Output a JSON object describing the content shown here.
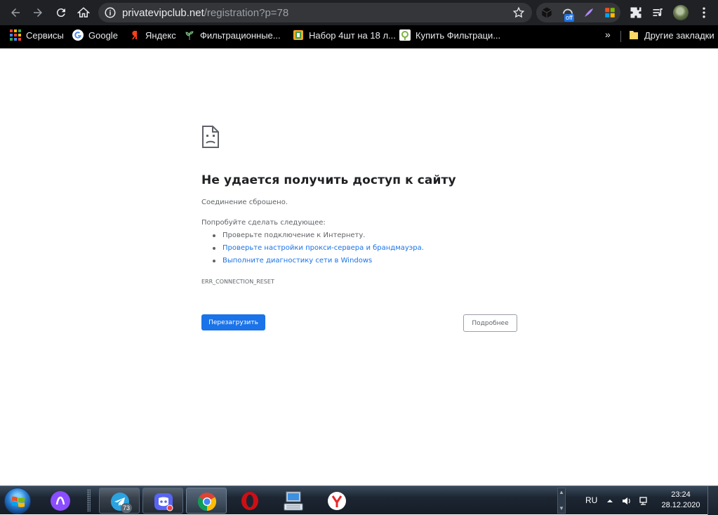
{
  "browser": {
    "url_host": "privatevipclub.net",
    "url_rest": "/registration?p=78",
    "extension_badge": "off"
  },
  "bookmarks": {
    "items": [
      {
        "label": "Сервисы",
        "icon": "apps-grid-icon"
      },
      {
        "label": "Google",
        "icon": "google-icon"
      },
      {
        "label": "Яндекс",
        "icon": "yandex-icon"
      },
      {
        "label": "Фильтрационные...",
        "icon": "plant-icon"
      },
      {
        "label": "Набор 4шт на 18 л...",
        "icon": "shop-icon"
      },
      {
        "label": "Купить Фильтраци...",
        "icon": "shop-leaf-icon"
      }
    ],
    "overflow": "»",
    "other_bookmarks": "Другие закладки"
  },
  "error": {
    "title": "Не удается получить доступ к сайту",
    "subtitle": "Соединение сброшено.",
    "try_heading": "Попробуйте сделать следующее:",
    "suggestions": [
      "Проверьте подключение к Интернету.",
      "Проверьте настройки прокси-сервера и брандмауэра.",
      "Выполните диагностику сети в Windows"
    ],
    "code": "ERR_CONNECTION_RESET",
    "reload_label": "Перезагрузить",
    "details_label": "Подробнее"
  },
  "taskbar": {
    "telegram_badge": "73",
    "language": "RU",
    "time": "23:24",
    "date": "28.12.2020"
  },
  "colors": {
    "accent": "#1a73e8",
    "toolbar_bg": "#202124",
    "text_primary": "#202124",
    "text_secondary": "#5f6368"
  }
}
